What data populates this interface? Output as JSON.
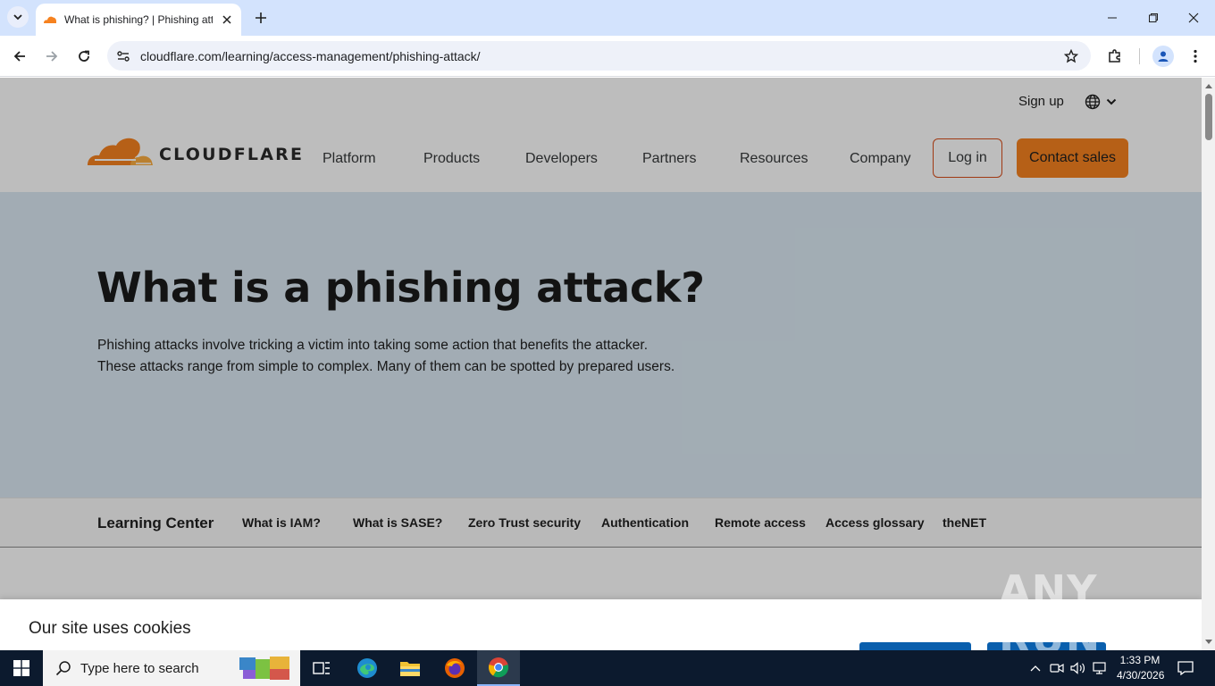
{
  "browser": {
    "tab_title": "What is phishing? | Phishing attack",
    "url": "cloudflare.com/learning/access-management/phishing-attack/"
  },
  "site": {
    "signup": "Sign up",
    "logo_text": "CLOUDFLARE",
    "nav": [
      "Platform",
      "Products",
      "Developers",
      "Partners",
      "Resources",
      "Company"
    ],
    "login": "Log in",
    "contact": "Contact sales"
  },
  "hero": {
    "title": "What is a phishing attack?",
    "description": "Phishing attacks involve tricking a victim into taking some action that benefits the attacker. These attacks range from simple to complex. Many of them can be spotted by prepared users."
  },
  "learning_nav": {
    "title": "Learning Center",
    "links": [
      "What is IAM?",
      "What is SASE?",
      "Zero Trust security",
      "Authentication",
      "Remote access",
      "Access glossary",
      "theNET"
    ]
  },
  "cookie": {
    "title": "Our site uses cookies"
  },
  "watermark": "ANY RUN",
  "taskbar": {
    "search_placeholder": "Type here to search",
    "time": "1:33 PM",
    "date": "4/30/2026"
  },
  "colors": {
    "accent_orange": "#f6821f",
    "hero_bg": "#dbe9f3",
    "cookie_button": "#0a5fad"
  }
}
